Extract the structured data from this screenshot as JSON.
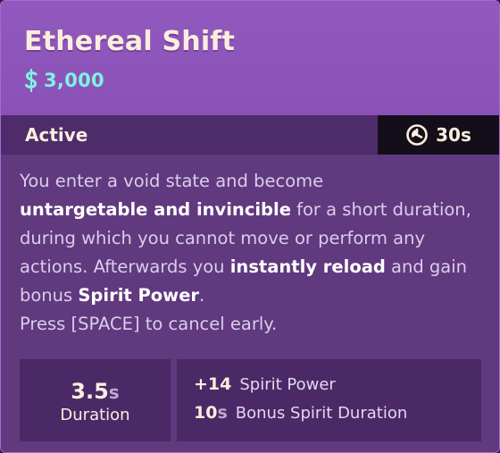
{
  "item": {
    "title": "Ethereal Shift",
    "cost_icon": "souls-currency-icon",
    "cost": "3,000",
    "colors": {
      "header": "#8a51b7",
      "body": "#60397f",
      "panel": "#4b2966",
      "cost": "#7ff2e0",
      "title": "#fbeede"
    }
  },
  "status": {
    "label": "Active",
    "cooldown_icon": "cooldown-clock-icon",
    "cooldown": "30s"
  },
  "description": {
    "t1": "You enter a void state and become",
    "b1": "untargetable and invincible",
    "t2": " for a short duration, during which you cannot move or perform any actions. Afterwards you ",
    "b2": "instantly reload",
    "t3": " and gain bonus ",
    "b3": "Spirit Power",
    "t4": ".",
    "t5": "Press [SPACE] to cancel early."
  },
  "stats": {
    "duration_value": "3.5",
    "duration_unit": "s",
    "duration_label": "Duration",
    "bonus": [
      {
        "value": "+14",
        "unit": "",
        "label": "Spirit Power"
      },
      {
        "value": "10",
        "unit": "s",
        "label": "Bonus Spirit Duration"
      }
    ]
  }
}
